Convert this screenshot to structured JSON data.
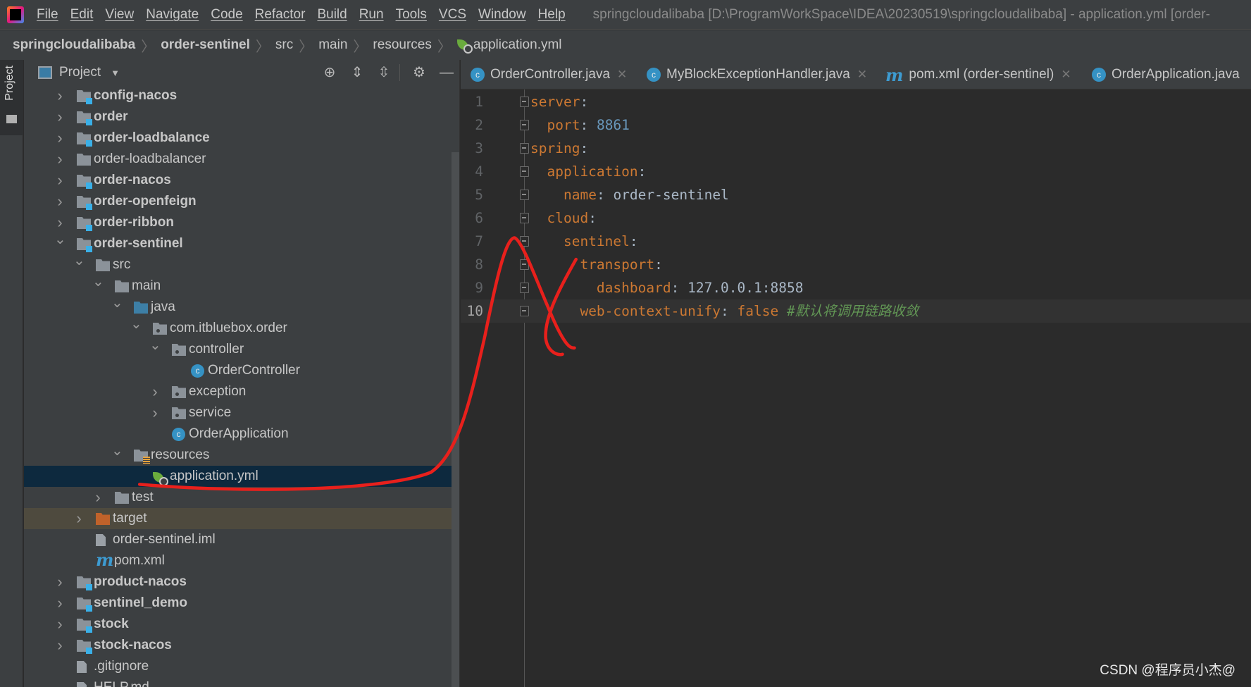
{
  "menubar": {
    "items": [
      "File",
      "Edit",
      "View",
      "Navigate",
      "Code",
      "Refactor",
      "Build",
      "Run",
      "Tools",
      "VCS",
      "Window",
      "Help"
    ],
    "window_title": "springcloudalibaba [D:\\ProgramWorkSpace\\IDEA\\20230519\\springcloudalibaba] - application.yml [order-"
  },
  "breadcrumb": [
    {
      "label": "springcloudalibaba",
      "bold": true
    },
    {
      "label": "order-sentinel",
      "bold": true
    },
    {
      "label": "src"
    },
    {
      "label": "main"
    },
    {
      "label": "resources"
    },
    {
      "label": "application.yml",
      "icon": "spring-config-icon"
    }
  ],
  "left_stripe": {
    "project_tab": "Project"
  },
  "project_panel": {
    "title": "Project",
    "toolbar_icons": [
      "locate-icon",
      "expand-all-icon",
      "collapse-all-icon",
      "gear-icon",
      "hide-icon"
    ],
    "tree": [
      {
        "level": 0,
        "label": "config-nacos",
        "icon": "module",
        "bold": true,
        "state": "collapsed"
      },
      {
        "level": 0,
        "label": "order",
        "icon": "module",
        "bold": true,
        "state": "collapsed"
      },
      {
        "level": 0,
        "label": "order-loadbalance",
        "icon": "module",
        "bold": true,
        "state": "collapsed"
      },
      {
        "level": 0,
        "label": "order-loadbalancer",
        "icon": "folder",
        "state": "collapsed"
      },
      {
        "level": 0,
        "label": "order-nacos",
        "icon": "module",
        "bold": true,
        "state": "collapsed"
      },
      {
        "level": 0,
        "label": "order-openfeign",
        "icon": "module",
        "bold": true,
        "state": "collapsed"
      },
      {
        "level": 0,
        "label": "order-ribbon",
        "icon": "module",
        "bold": true,
        "state": "collapsed"
      },
      {
        "level": 0,
        "label": "order-sentinel",
        "icon": "module",
        "bold": true,
        "state": "expanded"
      },
      {
        "level": 1,
        "label": "src",
        "icon": "folder",
        "state": "expanded"
      },
      {
        "level": 2,
        "label": "main",
        "icon": "folder",
        "state": "expanded"
      },
      {
        "level": 3,
        "label": "java",
        "icon": "source",
        "state": "expanded"
      },
      {
        "level": 4,
        "label": "com.itbluebox.order",
        "icon": "package",
        "state": "expanded"
      },
      {
        "level": 5,
        "label": "controller",
        "icon": "package",
        "state": "expanded"
      },
      {
        "level": 6,
        "label": "OrderController",
        "icon": "class"
      },
      {
        "level": 5,
        "label": "exception",
        "icon": "package",
        "state": "collapsed"
      },
      {
        "level": 5,
        "label": "service",
        "icon": "package",
        "state": "collapsed"
      },
      {
        "level": 5,
        "label": "OrderApplication",
        "icon": "spring-class"
      },
      {
        "level": 3,
        "label": "resources",
        "icon": "resources",
        "state": "expanded"
      },
      {
        "level": 4,
        "label": "application.yml",
        "icon": "spring-config",
        "selected": true
      },
      {
        "level": 2,
        "label": "test",
        "icon": "folder",
        "state": "collapsed"
      },
      {
        "level": 1,
        "label": "target",
        "icon": "excluded",
        "state": "collapsed",
        "excluded": true
      },
      {
        "level": 1,
        "label": "order-sentinel.iml",
        "icon": "file"
      },
      {
        "level": 1,
        "label": "pom.xml",
        "icon": "maven"
      },
      {
        "level": 0,
        "label": "product-nacos",
        "icon": "module",
        "bold": true,
        "state": "collapsed"
      },
      {
        "level": 0,
        "label": "sentinel_demo",
        "icon": "module",
        "bold": true,
        "state": "collapsed"
      },
      {
        "level": 0,
        "label": "stock",
        "icon": "module",
        "bold": true,
        "state": "collapsed"
      },
      {
        "level": 0,
        "label": "stock-nacos",
        "icon": "module",
        "bold": true,
        "state": "collapsed"
      },
      {
        "level": 0,
        "label": ".gitignore",
        "icon": "file"
      },
      {
        "level": 0,
        "label": "HELP.md",
        "icon": "file"
      }
    ]
  },
  "editor_tabs": [
    {
      "label": "OrderController.java",
      "icon": "class",
      "closable": true
    },
    {
      "label": "MyBlockExceptionHandler.java",
      "icon": "class",
      "closable": true
    },
    {
      "label": "pom.xml (order-sentinel)",
      "icon": "maven",
      "closable": true
    },
    {
      "label": "OrderApplication.java",
      "icon": "class",
      "closable": false
    }
  ],
  "editor": {
    "current_line": 10,
    "lines": [
      {
        "num": "1",
        "indent": "",
        "key": "server",
        "value": "",
        "value_type": "",
        "comment": ""
      },
      {
        "num": "2",
        "indent": "  ",
        "key": "port",
        "value": "8861",
        "value_type": "number",
        "comment": ""
      },
      {
        "num": "3",
        "indent": "",
        "key": "spring",
        "value": "",
        "value_type": "",
        "comment": ""
      },
      {
        "num": "4",
        "indent": "  ",
        "key": "application",
        "value": "",
        "value_type": "",
        "comment": ""
      },
      {
        "num": "5",
        "indent": "    ",
        "key": "name",
        "value": "order-sentinel",
        "value_type": "string",
        "comment": ""
      },
      {
        "num": "6",
        "indent": "  ",
        "key": "cloud",
        "value": "",
        "value_type": "",
        "comment": ""
      },
      {
        "num": "7",
        "indent": "    ",
        "key": "sentinel",
        "value": "",
        "value_type": "",
        "comment": ""
      },
      {
        "num": "8",
        "indent": "      ",
        "key": "transport",
        "value": "",
        "value_type": "",
        "comment": ""
      },
      {
        "num": "9",
        "indent": "        ",
        "key": "dashboard",
        "value": "127.0.0.1:8858",
        "value_type": "string",
        "comment": ""
      },
      {
        "num": "10",
        "indent": "      ",
        "key": "web-context-unify",
        "value": "false",
        "value_type": "keyword",
        "comment": "#默认将调用链路收敛"
      }
    ]
  },
  "colors": {
    "annotation": "#e8201c",
    "key": "#cc7832",
    "number": "#6897bb",
    "comment": "#629755",
    "selection": "#0d293e"
  },
  "watermark": "CSDN @程序员小杰@"
}
